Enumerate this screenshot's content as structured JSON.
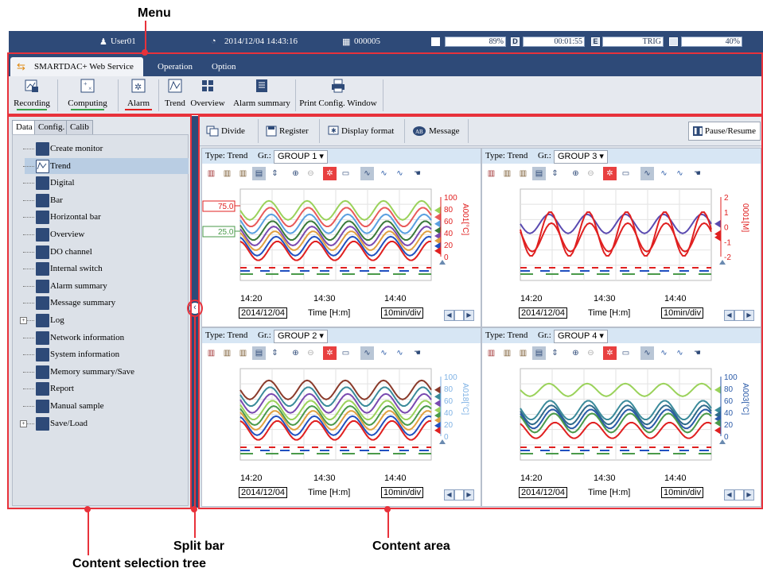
{
  "callouts": {
    "menu": "Menu",
    "split_bar": "Split bar",
    "content_area": "Content area",
    "content_selection_tree": "Content selection tree"
  },
  "status": {
    "user": "User01",
    "datetime": "2014/12/04 14:43:16",
    "count": "000005",
    "memory": "89%",
    "elapsed": "00:01:55",
    "trig": "TRIG",
    "battery": "40%",
    "d_icon": "D",
    "e_icon": "E"
  },
  "menu": {
    "tabs": [
      "SMARTDAC+ Web Service",
      "Operation",
      "Option"
    ]
  },
  "ribbon": {
    "buttons": [
      "Recording",
      "Computing",
      "Alarm",
      "Trend",
      "Overview",
      "Alarm summary",
      "Print Config. Window"
    ]
  },
  "tree": {
    "tabs": [
      "Data",
      "Config.",
      "Calib"
    ],
    "items": [
      "Create monitor",
      "Trend",
      "Digital",
      "Bar",
      "Horizontal bar",
      "Overview",
      "DO channel",
      "Internal switch",
      "Alarm summary",
      "Message summary",
      "Log",
      "Network information",
      "System information",
      "Memory summary/Save",
      "Report",
      "Manual sample",
      "Save/Load"
    ],
    "selected": "Trend"
  },
  "toolbar": {
    "divide": "Divide",
    "register": "Register",
    "display_format": "Display format",
    "message": "Message",
    "pause": "Pause/Resume"
  },
  "panes": [
    {
      "type_label": "Type: Trend",
      "gr_label": "Gr.:",
      "group": "GROUP 1",
      "time1": "14:20",
      "time2": "14:30",
      "time3": "14:40",
      "date": "2014/12/04",
      "axis": "Time [H:m]",
      "div": "10min/div",
      "scale": [
        "100",
        "80",
        "60",
        "40",
        "20",
        "0"
      ],
      "scale_label": "A001[°C]",
      "scale_color": "#e02020",
      "marks": [
        "75.0",
        "25.0"
      ]
    },
    {
      "type_label": "Type: Trend",
      "gr_label": "Gr.:",
      "group": "GROUP 3",
      "time1": "14:20",
      "time2": "14:30",
      "time3": "14:40",
      "date": "2014/12/04",
      "axis": "Time [H:m]",
      "div": "10min/div",
      "scale": [
        "2",
        "1",
        "0",
        "-1",
        "-2"
      ],
      "scale_label": "0001[M]",
      "scale_color": "#e02020",
      "marks": []
    },
    {
      "type_label": "Type: Trend",
      "gr_label": "Gr.:",
      "group": "GROUP 2",
      "time1": "14:20",
      "time2": "14:30",
      "time3": "14:40",
      "date": "2014/12/04",
      "axis": "Time [H:m]",
      "div": "10min/div",
      "scale": [
        "100",
        "80",
        "60",
        "40",
        "20",
        "0"
      ],
      "scale_label": "A018[°C]",
      "scale_color": "#7fb2e5",
      "marks": []
    },
    {
      "type_label": "Type: Trend",
      "gr_label": "Gr.:",
      "group": "GROUP 4",
      "time1": "14:20",
      "time2": "14:30",
      "time3": "14:40",
      "date": "2014/12/04",
      "axis": "Time [H:m]",
      "div": "10min/div",
      "scale": [
        "100",
        "80",
        "60",
        "40",
        "20",
        "0"
      ],
      "scale_label": "A003[°C]",
      "scale_color": "#2a5aa8",
      "marks": []
    }
  ],
  "colors": {
    "accent": "#e8323b",
    "header": "#2e4a78",
    "selected": "#b9cde3"
  }
}
